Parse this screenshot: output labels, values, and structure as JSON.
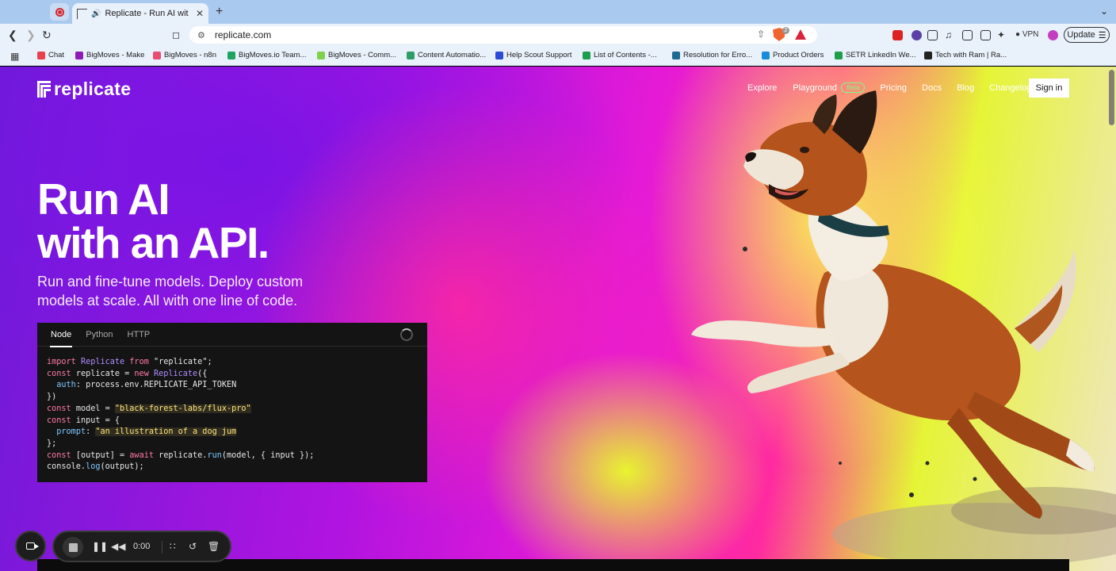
{
  "browser": {
    "tab_title": "Replicate - Run AI with an API",
    "new_tab_symbol": "+",
    "url": "replicate.com",
    "vpn_label": "VPN",
    "update_label": "Update",
    "brave_badge_count": "2"
  },
  "bookmarks": [
    {
      "label": "Chat",
      "color": "#e8414b"
    },
    {
      "label": "BigMoves - Make",
      "color": "#8e1ab8"
    },
    {
      "label": "BigMoves - n8n",
      "color": "#ea4b71"
    },
    {
      "label": "BigMoves.io Team...",
      "color": "#1fa463"
    },
    {
      "label": "BigMoves - Comm...",
      "color": "#7fd14a"
    },
    {
      "label": "Content Automatio...",
      "color": "#2d9e6a"
    },
    {
      "label": "Help Scout Support",
      "color": "#2b4bd8"
    },
    {
      "label": "List of Contents -...",
      "color": "#1e9e4a"
    },
    {
      "label": "Resolution for Erro...",
      "color": "#1d6c8f"
    },
    {
      "label": "Product Orders",
      "color": "#1a8bd6"
    },
    {
      "label": "SETR LinkedIn We...",
      "color": "#1e9e4a"
    },
    {
      "label": "Tech with Ram | Ra...",
      "color": "#222222"
    }
  ],
  "site": {
    "logo_text": "replicate",
    "nav": {
      "explore": "Explore",
      "playground": "Playground",
      "beta": "Beta",
      "pricing": "Pricing",
      "docs": "Docs",
      "blog": "Blog",
      "changelog": "Changelog",
      "signin": "Sign in"
    },
    "hero_line1": "Run AI",
    "hero_line2": "with an API.",
    "hero_sub": "Run and fine-tune models. Deploy custom models at scale. All with one line of code.",
    "code_tabs": [
      "Node",
      "Python",
      "HTTP"
    ],
    "code": {
      "l1_import": "import",
      "l1_cls": "Replicate",
      "l1_from": "from",
      "l1_str": "\"replicate\"",
      "l2_const": "const",
      "l2_name": "replicate =",
      "l2_new": "new",
      "l2_cls": "Replicate",
      "l3_prop": "auth",
      "l3_val": ": process.env.REPLICATE_API_TOKEN",
      "l4": "})",
      "l5_const": "const",
      "l5_name": "model =",
      "l5_str": "\"black-forest-labs/flux-pro\"",
      "l6_const": "const",
      "l6_name": "input = {",
      "l7_prop": "prompt",
      "l7_str": "\"an illustration of a dog jum",
      "l8": "};",
      "l9_const": "const",
      "l9_name": "[output] =",
      "l9_await": "await",
      "l9_obj": "replicate.",
      "l9_fn": "run",
      "l9_rest": "(model, { input });",
      "l10_obj": "console.",
      "l10_fn": "log",
      "l10_rest": "(output);"
    }
  },
  "recorder": {
    "time": "0:00"
  }
}
